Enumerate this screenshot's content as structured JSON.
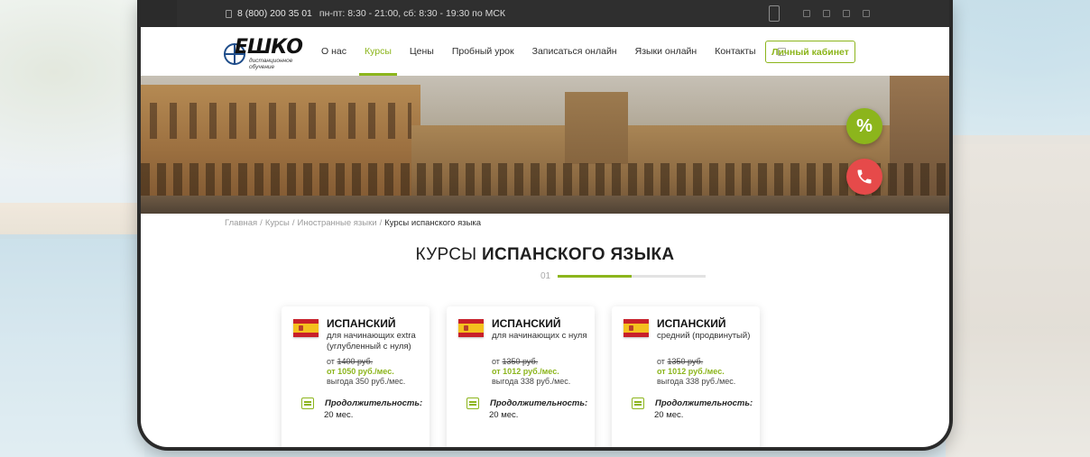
{
  "topbar": {
    "phone": "8 (800) 200 35 01",
    "hours": "пн-пт: 8:30 - 21:00, сб: 8:30 - 19:30 по МСК"
  },
  "logo": {
    "word": "ЕШКО",
    "sub_line1": "дистанционное",
    "sub_line2": "обучение"
  },
  "nav": {
    "items": [
      {
        "label": "О нас",
        "active": false
      },
      {
        "label": "Курсы",
        "active": true
      },
      {
        "label": "Цены",
        "active": false
      },
      {
        "label": "Пробный урок",
        "active": false
      },
      {
        "label": "Записаться онлайн",
        "active": false
      },
      {
        "label": "Языки онлайн",
        "active": false
      },
      {
        "label": "Контакты",
        "active": false
      }
    ],
    "cabinet_label": "Личный кабинет"
  },
  "fab": {
    "discount_label": "%"
  },
  "breadcrumb": {
    "items": [
      "Главная",
      "Курсы",
      "Иностранные языки"
    ],
    "separator": "/",
    "current": "Курсы испанского языка"
  },
  "title": {
    "light": "КУРСЫ",
    "bold": "ИСПАНСКОГО ЯЗЫКА"
  },
  "slider": {
    "number": "01",
    "progress": 0.5
  },
  "cards": [
    {
      "lang": "ИСПАНСКИЙ",
      "desc": "для начинающих extra (углубленный с нуля)",
      "from": "от",
      "old_price": "1400 руб.",
      "new_price": "от 1050 руб./мес.",
      "benefit": "выгода 350 руб./мес.",
      "duration_label": "Продолжительность:",
      "duration_value": "20 мес."
    },
    {
      "lang": "ИСПАНСКИЙ",
      "desc": "для начинающих с нуля",
      "from": "от",
      "old_price": "1350 руб.",
      "new_price": "от 1012 руб./мес.",
      "benefit": "выгода 338 руб./мес.",
      "duration_label": "Продолжительность:",
      "duration_value": "20 мес."
    },
    {
      "lang": "ИСПАНСКИЙ",
      "desc": "средний (продвинутый)",
      "from": "от",
      "old_price": "1350 руб.",
      "new_price": "от 1012 руб./мес.",
      "benefit": "выгода 338 руб./мес.",
      "duration_label": "Продолжительность:",
      "duration_value": "20 мес."
    }
  ],
  "colors": {
    "accent": "#8cb51c",
    "call": "#e64a4a",
    "topbar": "#2f2f2f"
  }
}
